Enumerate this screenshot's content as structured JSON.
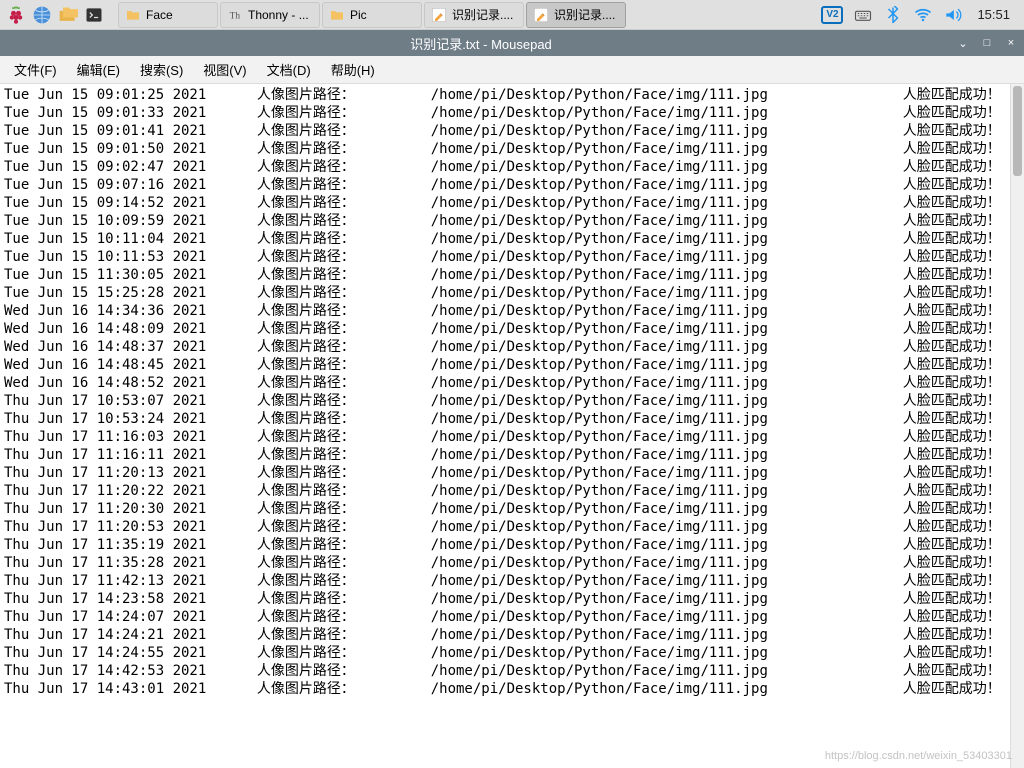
{
  "taskbar": {
    "apps": [
      {
        "name": "raspberry-menu",
        "icon": "raspberry"
      },
      {
        "name": "web-browser",
        "icon": "globe"
      },
      {
        "name": "file-manager",
        "icon": "folders"
      },
      {
        "name": "terminal",
        "icon": "terminal"
      }
    ],
    "tasks": [
      {
        "label": "Face",
        "icon": "folder",
        "name": "task-face-folder"
      },
      {
        "label": "Thonny  - ...",
        "icon": "thonny",
        "name": "task-thonny"
      },
      {
        "label": "Pic",
        "icon": "folder",
        "name": "task-pic-folder"
      },
      {
        "label": "识别记录....",
        "icon": "pencil",
        "name": "task-mousepad-1"
      },
      {
        "label": "识别记录....",
        "icon": "pencil",
        "name": "task-mousepad-2",
        "active": true
      }
    ],
    "tray": {
      "vnc_label": "V2",
      "clock": "15:51"
    }
  },
  "window": {
    "title": "识别记录.txt - Mousepad",
    "minimize": "⌄",
    "maximize": "□",
    "close": "×"
  },
  "menu": {
    "items": [
      "文件(F)",
      "编辑(E)",
      "搜索(S)",
      "视图(V)",
      "文档(D)",
      "帮助(H)"
    ]
  },
  "log": {
    "label": "人像图片路径：",
    "path": "/home/pi/Desktop/Python/Face/img/111.jpg",
    "result": "人脸匹配成功！",
    "rows": [
      "Tue Jun 15 09:01:25 2021",
      "Tue Jun 15 09:01:33 2021",
      "Tue Jun 15 09:01:41 2021",
      "Tue Jun 15 09:01:50 2021",
      "Tue Jun 15 09:02:47 2021",
      "Tue Jun 15 09:07:16 2021",
      "Tue Jun 15 09:14:52 2021",
      "Tue Jun 15 10:09:59 2021",
      "Tue Jun 15 10:11:04 2021",
      "Tue Jun 15 10:11:53 2021",
      "Tue Jun 15 11:30:05 2021",
      "Tue Jun 15 15:25:28 2021",
      "Wed Jun 16 14:34:36 2021",
      "Wed Jun 16 14:48:09 2021",
      "Wed Jun 16 14:48:37 2021",
      "Wed Jun 16 14:48:45 2021",
      "Wed Jun 16 14:48:52 2021",
      "Thu Jun 17 10:53:07 2021",
      "Thu Jun 17 10:53:24 2021",
      "Thu Jun 17 11:16:03 2021",
      "Thu Jun 17 11:16:11 2021",
      "Thu Jun 17 11:20:13 2021",
      "Thu Jun 17 11:20:22 2021",
      "Thu Jun 17 11:20:30 2021",
      "Thu Jun 17 11:20:53 2021",
      "Thu Jun 17 11:35:19 2021",
      "Thu Jun 17 11:35:28 2021",
      "Thu Jun 17 11:42:13 2021",
      "Thu Jun 17 14:23:58 2021",
      "Thu Jun 17 14:24:07 2021",
      "Thu Jun 17 14:24:21 2021",
      "Thu Jun 17 14:24:55 2021",
      "Thu Jun 17 14:42:53 2021",
      "Thu Jun 17 14:43:01 2021"
    ]
  },
  "watermark": "https://blog.csdn.net/weixin_53403301"
}
